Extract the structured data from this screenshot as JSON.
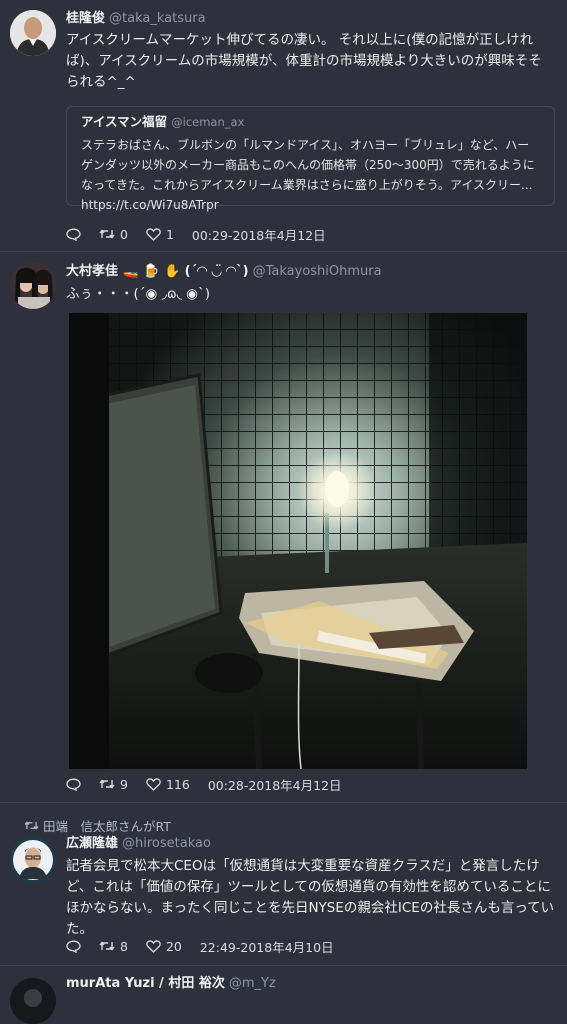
{
  "tweets": [
    {
      "name": "桂隆俊",
      "handle": "@taka_katsura",
      "text": "アイスクリームマーケット伸びてるの凄い。 それ以上に(僕の記憶が正しければ)、アイスクリームの市場規模が、体重計の市場規模より大きいのが興味そそられる^_^",
      "quote": {
        "name": "アイスマン福留",
        "handle": "@iceman_ax",
        "text": "ステラおばさん、ブルボンの「ルマンドアイス」、オハヨー「ブリュレ」など、ハーゲンダッツ以外のメーカー商品もこのへんの価格帯（250〜300円）で売れるようになってきた。これからアイスクリーム業界はさらに盛り上がりそう。アイスクリー... https://t.co/Wi7u8ATrpr"
      },
      "retweets": "0",
      "likes": "1",
      "time": "00:29-2018年4月12日"
    },
    {
      "name": "大村孝佳 🚤 🍺 ✋ (´◠ ◡̈  ◠`)",
      "handle": "@TakayoshiOhmura",
      "text": "ふぅ・・・(´◉ ◞ɷ◟ ◉`)",
      "retweets": "9",
      "likes": "116",
      "time": "00:28-2018年4月12日"
    },
    {
      "rt_label": "田端　信太郎さんがRT",
      "name": "広瀬隆雄",
      "handle": "@hirosetakao",
      "text": "記者会見で松本大CEOは「仮想通貨は大変重要な資産クラスだ」と発言したけど、これは「価値の保存」ツールとしての仮想通貨の有効性を認めていることにほかならない。まったく同じことを先日NYSEの親会社ICEの社長さんも言っていた。",
      "retweets": "8",
      "likes": "20",
      "time": "22:49-2018年4月10日"
    },
    {
      "name": "murAta Yuzi / 村田 裕次",
      "handle": "@m_Yz"
    }
  ]
}
